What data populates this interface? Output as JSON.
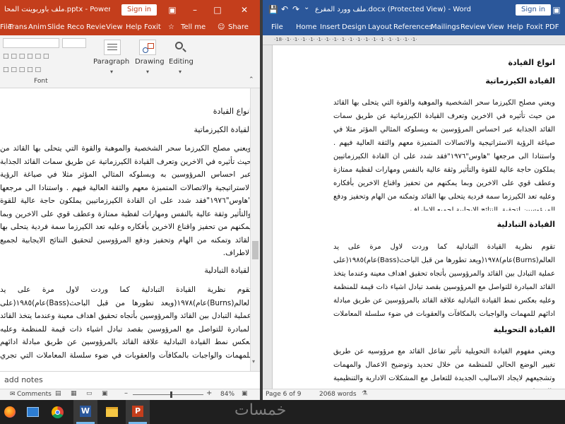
{
  "ppt": {
    "title": "ملف باوربوينت المحا.pptx - PowerPoint",
    "signin": "Sign in",
    "tabs": [
      "File",
      "Trans",
      "Anim",
      "Slide",
      "Reco",
      "Revie",
      "View",
      "Help",
      "Foxit"
    ],
    "tell_me": "Tell me",
    "share": "Share",
    "ribbon_groups": [
      "Paragraph",
      "Drawing",
      "Editing"
    ],
    "font_group": "Font",
    "outline": {
      "h1": "انواع القيادة",
      "h2": "القيادة الكيرزماتية",
      "p1": "ويعني مصلح الكيرزما سحر الشخصية والموهبة والقوة التي يتحلى بها القائد من حيث تأثيره في الاخرين وتعرف القيادة الكيرزماتية عن طريق سمات القائد الجذابة عبر احساس المرؤوسين به وبسلوكه المثالي المؤثر مثلا في صياغة الرؤية الاستراتيجية والاتصالات المتميزة معهم والثقة العالية فيهم . واستنادا الى مرجعها \"هاوس\"١٩٧٦\"فقد شدد على ان القادة الكيرزماتيين يملكون حاجة عالية للقوة والتأثير وثقة عالية بالنفس ومهارات لفظية ممتازة وعطف قوي على الاخرين وبما يمكنهم من تحفيز واقناع الاخرين بأفكاره وعليه تعد الكيرزما سمة فردية يتحلى بها القائد وتمكنه من الهام وتحفيز ودفع المرؤوسين لتحقيق النتائج الايجابية لجميع الاطراف.",
      "h3": "القيادة التبادلية",
      "p2": "تقوم نظرية القيادة التبادلية كما وردت لاول مرة على يد العالم(Burns)عام)١٩٧٨(ويعد تطورها من قبل الباحث(Bass)عام)١٩٨٥(على عملية التبادل بين القائد والمرؤوسين بأتجاه تحقيق اهداف معينة وعندما يتخذ القائد المبادرة للتواصل مع المرؤوسين بقصد تبادل اشياء ذات قيمة للمنظمة وعليه بعكس نمط القيادة التبادلية علاقة القائد بالمرؤوسين عن طريق مبادلة ادائهم للمهمات والواجبات بالمكافآت والعقوبات في ضوء سلسلة المعاملات التي تجري من قبلهم."
    },
    "notes": "add notes",
    "comments": "Comments",
    "zoom": "84%"
  },
  "word": {
    "title": "ملف وورد المفرع.docx (Protected View) - Word",
    "signin": "Sign in",
    "tabs": [
      "File",
      "Home",
      "Insert",
      "Design",
      "Layout",
      "References",
      "Mailings",
      "Review",
      "View",
      "Help",
      "Foxit PDF"
    ],
    "ruler": "·18· ·1· ·1· ·1· ·1· ·1· ·1· ·1· ·1· ·1· ·1· ·1· ·1· ·1· ·1· ·1· ·1· ·1·",
    "doc": {
      "h1": "انواع القيادة",
      "h2": "القيادة الكيرزماتية",
      "p1": "ويعني مصلح الكيرزما سحر الشخصية والموهبة والقوة التي يتحلى بها القائد من حيث تأثيره في الاخرين وتعرف القيادة الكيرزماتية عن طريق سمات القائد الجذابة عبر احساس المرؤوسين به وبسلوكه المثالي المؤثر مثلا في صياغة الرؤية الاستراتيجية والاتصالات المتميزة معهم والثقة العالية فيهم . واستنادا الى مرجعها \"هاوس\"١٩٧٦\"فقد شدد على ان القادة الكيرزماتيين يملكون حاجة عالية للقوة والتأثير وثقة عالية بالنفس ومهارات لفظية ممتازة وعطف قوي على الاخرين وبما يمكنهم من تحفيز واقناع الاخرين بأفكاره وعليه تعد الكيرزما سمة فردية يتحلى بها القائد وتمكنه من الهام وتحفيز ودفع المرؤوسين لتحقيق النتائج الايجابية لجميع الاطراف.",
      "h3": "القيادة التبادلية",
      "p2": "تقوم نظرية القيادة التبادلية كما وردت لاول مرة على يد العالم(Burns)عام)١٩٧٨(ويعد تطورها من قبل الباحث(Bass)عام)١٩٨٥(على عملية التبادل بين القائد والمرؤوسين بأتجاه تحقيق اهداف معينة وعندما يتخذ القائد المبادرة للتواصل مع المرؤوسين بقصد تبادل اشياء ذات قيمة للمنظمة وعليه بعكس نمط القيادة التبادلية علاقة القائد بالمرؤوسين عن طريق مبادلة ادائهم للمهمات والواجبات بالمكافآت والعقوبات في ضوء سلسلة المعاملات التي تجري من قبله.",
      "h4": "القيادة التحويلية",
      "p3": "ويعني مفهوم القيادة التحويلية تأثير تفاعل القائد مع مرؤوسيه عن طريق تغيير الوضع الحالي للمنظمة من خلال تحديد وتوضيح الاعمال والمهمات وتشجيعهم لايجاد الاساليب الجديدة للتعامل مع المشكلات الادارية والتنظيمية والاجتماعية"
    },
    "status_page": "Page 6 of 9",
    "status_words": "2068 words"
  },
  "taskbar": {
    "apps": [
      "firefox-icon",
      "windows-settings-icon",
      "chrome-icon",
      "word-icon",
      "file-explorer-icon",
      "powerpoint-icon"
    ],
    "watermark": "خمسات"
  },
  "colors": {
    "ppt_brand": "#c43e1c",
    "word_brand": "#2b579a",
    "taskbar": "#1f1f1f"
  }
}
